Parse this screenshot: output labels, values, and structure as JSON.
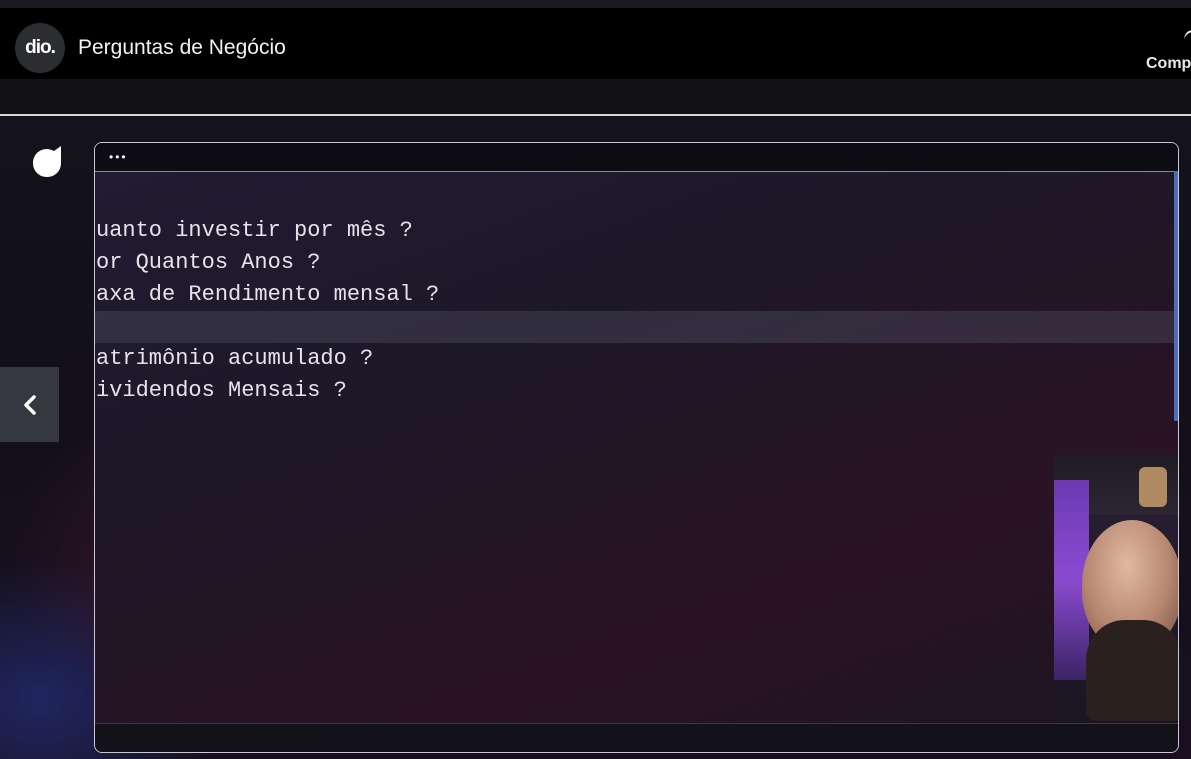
{
  "header": {
    "logo_text": "dio.",
    "title": "Perguntas de Negócio",
    "share_label": "Comp"
  },
  "editor": {
    "dots": "•••",
    "lines": [
      {
        "text": "",
        "highlight": false
      },
      {
        "text": "uanto investir por mês ?",
        "highlight": false
      },
      {
        "text": "or Quantos Anos ?",
        "highlight": false
      },
      {
        "text": "axa de Rendimento mensal ?",
        "highlight": false
      },
      {
        "text": "",
        "highlight": true
      },
      {
        "text": "atrimônio acumulado ?",
        "highlight": false
      },
      {
        "text": "ividendos Mensais ?",
        "highlight": false
      }
    ]
  },
  "icons": {
    "side_logo": "dio-drop-icon",
    "prev": "chevron-left-icon",
    "share": "share-arrow-icon"
  },
  "colors": {
    "header_bg": "#000000",
    "editor_scrollbar": "#4a6fb8"
  }
}
